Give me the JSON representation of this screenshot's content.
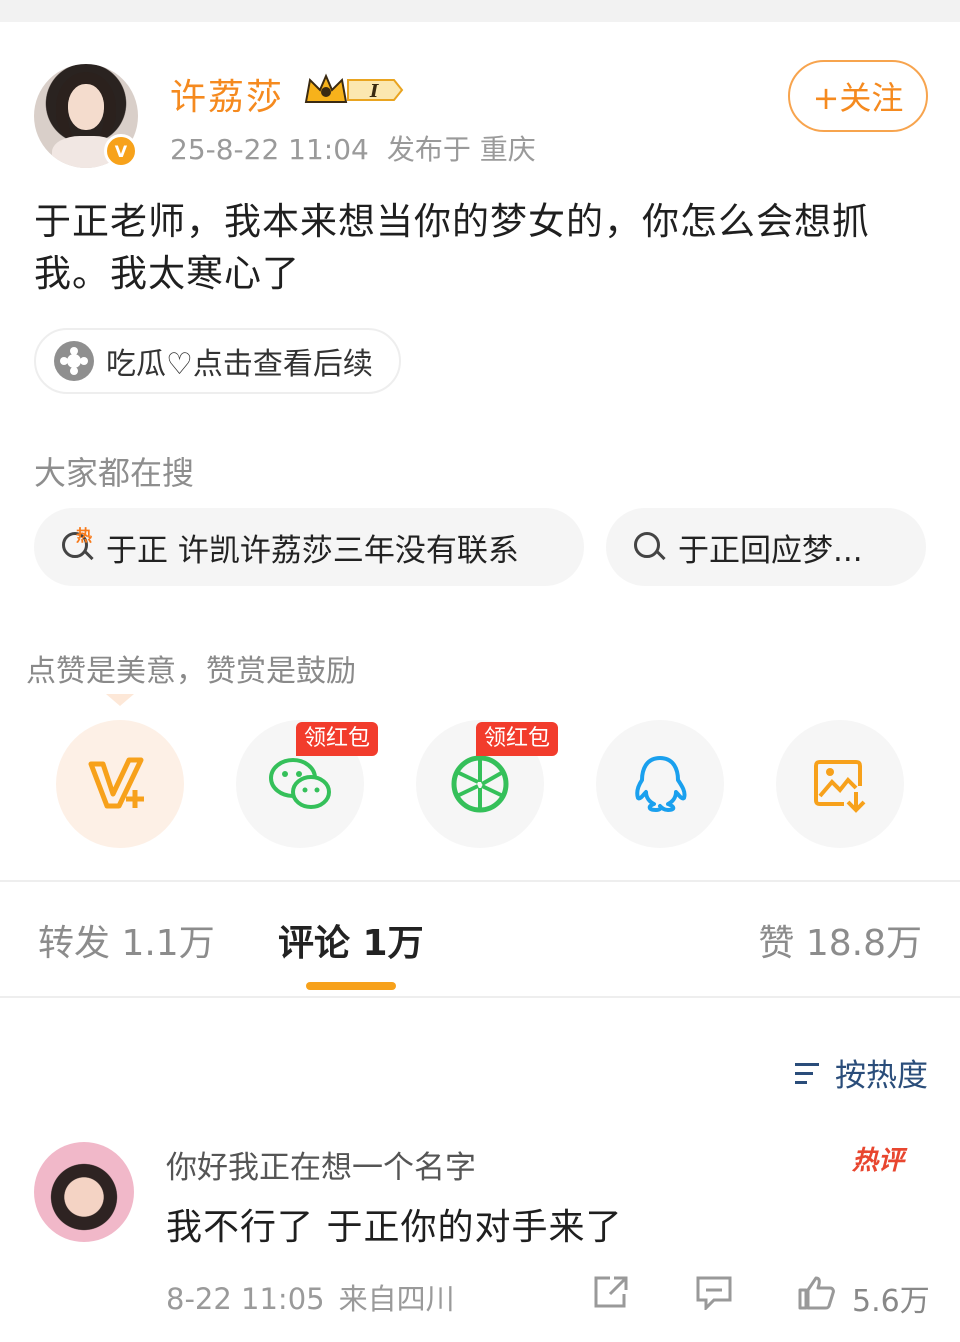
{
  "post": {
    "username": "许荔莎",
    "level": "I",
    "verified_mark": "V",
    "time": "25-8-22 11:04",
    "location": "发布于 重庆",
    "follow_label": "+关注",
    "text": "于正老师，我本来想当你的梦女的，你怎么会想抓我。我太寒心了",
    "topic": "吃瓜♡点击查看后续"
  },
  "search": {
    "title": "大家都在搜",
    "hot_badge": "热",
    "chips": [
      "于正 许凯许荔莎三年没有联系",
      "于正回应梦..."
    ]
  },
  "share": {
    "tip": "点赞是美意，赞赏是鼓励",
    "red_packet_label": "领红包",
    "icons": [
      "reward-icon",
      "wechat-icon",
      "moments-icon",
      "qq-icon",
      "save-image-icon"
    ],
    "colors": {
      "wechat": "#35c05a",
      "qq": "#1aa0ee",
      "reward": "#f7a11b"
    }
  },
  "tabs": {
    "repost": "转发 1.1万",
    "comments": "评论 1万",
    "likes": "赞 18.8万"
  },
  "sort_label": "按热度",
  "comment": {
    "user": "你好我正在想一个名字",
    "badge": "热评",
    "text": "我不行了 于正你的对手来了",
    "time": "8-22 11:05",
    "location": "来自四川",
    "likes": "5.6万"
  }
}
